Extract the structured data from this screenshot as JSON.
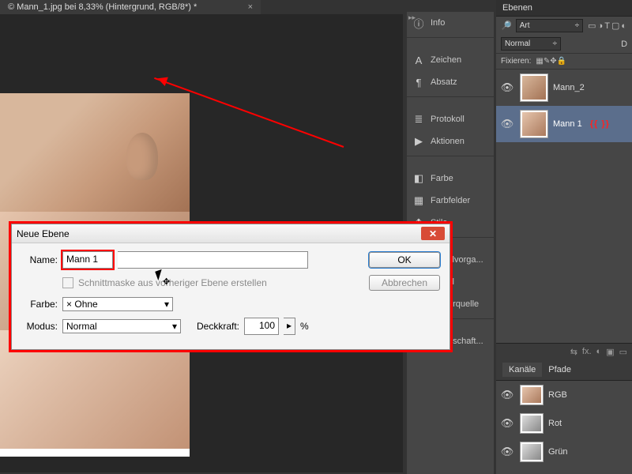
{
  "doc_tab": {
    "title": "© Mann_1.jpg bei 8,33% (Hintergrund, RGB/8*) *",
    "close": "×"
  },
  "toolcol": {
    "items": [
      {
        "icon": "ⓘ",
        "label": "Info"
      },
      {
        "icon": "A",
        "label": "Zeichen"
      },
      {
        "icon": "¶",
        "label": "Absatz"
      },
      {
        "icon": "≣",
        "label": "Protokoll"
      },
      {
        "icon": "▶",
        "label": "Aktionen"
      },
      {
        "icon": "◧",
        "label": "Farbe"
      },
      {
        "icon": "▦",
        "label": "Farbfelder"
      },
      {
        "icon": "❖",
        "label": "Stile"
      },
      {
        "icon": "✎",
        "label": "Pinselvorga..."
      },
      {
        "icon": "✔",
        "label": "Pinsel"
      },
      {
        "icon": "⧉",
        "label": "Kopierquelle"
      },
      {
        "icon": "⛭",
        "label": "Eigenschaft..."
      }
    ],
    "groups": [
      [
        0
      ],
      [
        1,
        2
      ],
      [
        3,
        4
      ],
      [
        5,
        6,
        7
      ],
      [
        8,
        9,
        10
      ],
      [
        11
      ]
    ]
  },
  "layers_panel": {
    "tab": "Ebenen",
    "kind": "Art",
    "kind_arrow": "÷",
    "icons_right": [
      "▭",
      "◑",
      "T",
      "▢",
      "◐"
    ],
    "blend": "Normal",
    "blend_arrow": "÷",
    "opacity_label": "D",
    "lock_label": "Fixieren:",
    "lock_icons": [
      "▦",
      "✎",
      "✥",
      "🔒"
    ],
    "layers": [
      {
        "name": "Mann_2",
        "selected": false,
        "thumb": "s1"
      },
      {
        "name": "Mann 1",
        "selected": true,
        "thumb": "s2",
        "brackets": "{{   }}"
      }
    ],
    "foot_icons": [
      "⇆",
      "fx.",
      "◐",
      "▣",
      "▭"
    ]
  },
  "channels_panel": {
    "tabs": [
      "Kanäle",
      "Pfade"
    ],
    "active": 0,
    "items": [
      {
        "name": "RGB",
        "thumb": "s2"
      },
      {
        "name": "Rot",
        "thumb": "g"
      },
      {
        "name": "Grün",
        "thumb": "g"
      }
    ]
  },
  "dialog": {
    "title": "Neue Ebene",
    "name_label": "Name:",
    "name_value": "Mann 1",
    "clipmask": "Schnittmaske aus vorheriger Ebene erstellen",
    "color_label": "Farbe:",
    "color_value": "Ohne",
    "color_x": "×",
    "mode_label": "Modus:",
    "mode_value": "Normal",
    "opacity_label": "Deckkraft:",
    "opacity_value": "100",
    "opacity_unit": "%",
    "ok": "OK",
    "cancel": "Abbrechen"
  }
}
